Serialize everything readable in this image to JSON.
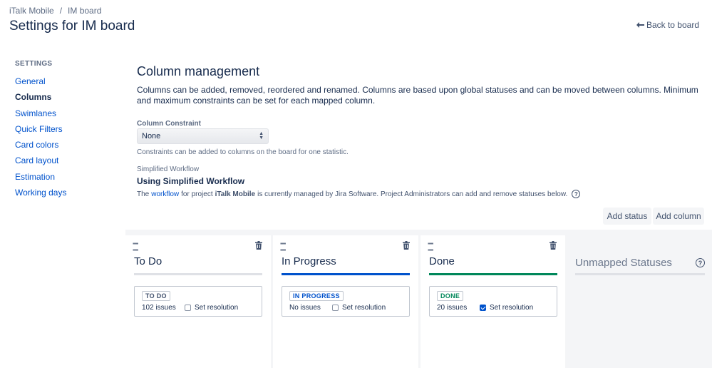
{
  "breadcrumbs": {
    "project": "iTalk Mobile",
    "separator": "/",
    "board": "IM board"
  },
  "page_title": "Settings for IM board",
  "back_link": "Back to board",
  "sidebar": {
    "section_title": "SETTINGS",
    "items": [
      {
        "label": "General"
      },
      {
        "label": "Columns",
        "active": true
      },
      {
        "label": "Swimlanes"
      },
      {
        "label": "Quick Filters"
      },
      {
        "label": "Card colors"
      },
      {
        "label": "Card layout"
      },
      {
        "label": "Estimation"
      },
      {
        "label": "Working days"
      }
    ]
  },
  "main": {
    "heading": "Column management",
    "description": "Columns can be added, removed, reordered and renamed. Columns are based upon global statuses and can be moved between columns. Minimum and maximum constraints can be set for each mapped column.",
    "constraint_label": "Column Constraint",
    "constraint_value": "None",
    "constraint_hint": "Constraints can be added to columns on the board for one statistic.",
    "simplified_label": "Simplified Workflow",
    "simplified_heading": "Using Simplified Workflow",
    "simplified_text_1": "The",
    "simplified_link": "workflow",
    "simplified_text_2": "for project",
    "simplified_project": "iTalk Mobile",
    "simplified_text_3": "is currently managed by Jira Software. Project Administrators can add and remove statuses below.",
    "help_glyph": "?"
  },
  "buttons": {
    "add_status": "Add status",
    "add_column": "Add column"
  },
  "columns": [
    {
      "title": "To Do",
      "status": "TO DO",
      "count": "102 issues",
      "resolution": "Set resolution",
      "checked": false,
      "bar_color": "#dfe1e6",
      "lozenge_color": "#42526e"
    },
    {
      "title": "In Progress",
      "status": "IN PROGRESS",
      "count": "No issues",
      "resolution": "Set resolution",
      "checked": false,
      "bar_color": "#0052cc",
      "lozenge_color": "#0052cc"
    },
    {
      "title": "Done",
      "status": "DONE",
      "count": "20 issues",
      "resolution": "Set resolution",
      "checked": true,
      "bar_color": "#00875a",
      "lozenge_color": "#00875a"
    }
  ],
  "unmapped": {
    "title": "Unmapped Statuses",
    "help_glyph": "?"
  },
  "icons": {
    "drag": "drag-handle-icon",
    "trash": "trash-icon",
    "back": "arrow-left-icon",
    "help": "help-icon"
  }
}
